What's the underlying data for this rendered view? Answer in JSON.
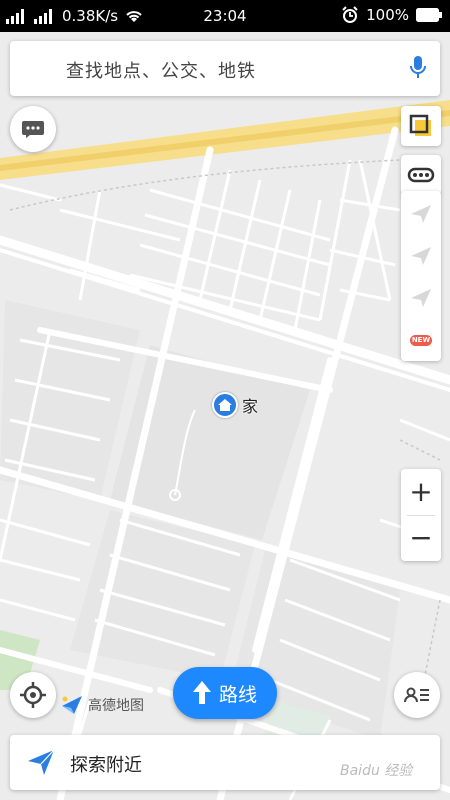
{
  "status_bar": {
    "net_speed": "0.38K/s",
    "time": "23:04",
    "battery": "100%",
    "icons": [
      "signal-icon",
      "wifi-icon",
      "alarm-icon",
      "battery-icon"
    ]
  },
  "search": {
    "placeholder": "查找地点、公交、地铁",
    "mic_icon": "microphone-icon"
  },
  "map": {
    "poi_home_label": "家",
    "logo_text": "高德地图"
  },
  "right_panel": {
    "layers_icon": "layers-icon",
    "traffic_icon": "traffic-icon",
    "tool_icons": [
      "send-icon",
      "send-icon",
      "send-icon"
    ],
    "new_badge": "NEW"
  },
  "zoom": {
    "in": "+",
    "out": "−"
  },
  "route_button": {
    "label": "路线"
  },
  "bottom": {
    "label": "探索附近"
  },
  "watermark": "Baidu 经验",
  "colors": {
    "accent": "#1e88ff",
    "road_main": "#f5d77b",
    "map_bg": "#ececec",
    "badge": "#f05a4a"
  }
}
